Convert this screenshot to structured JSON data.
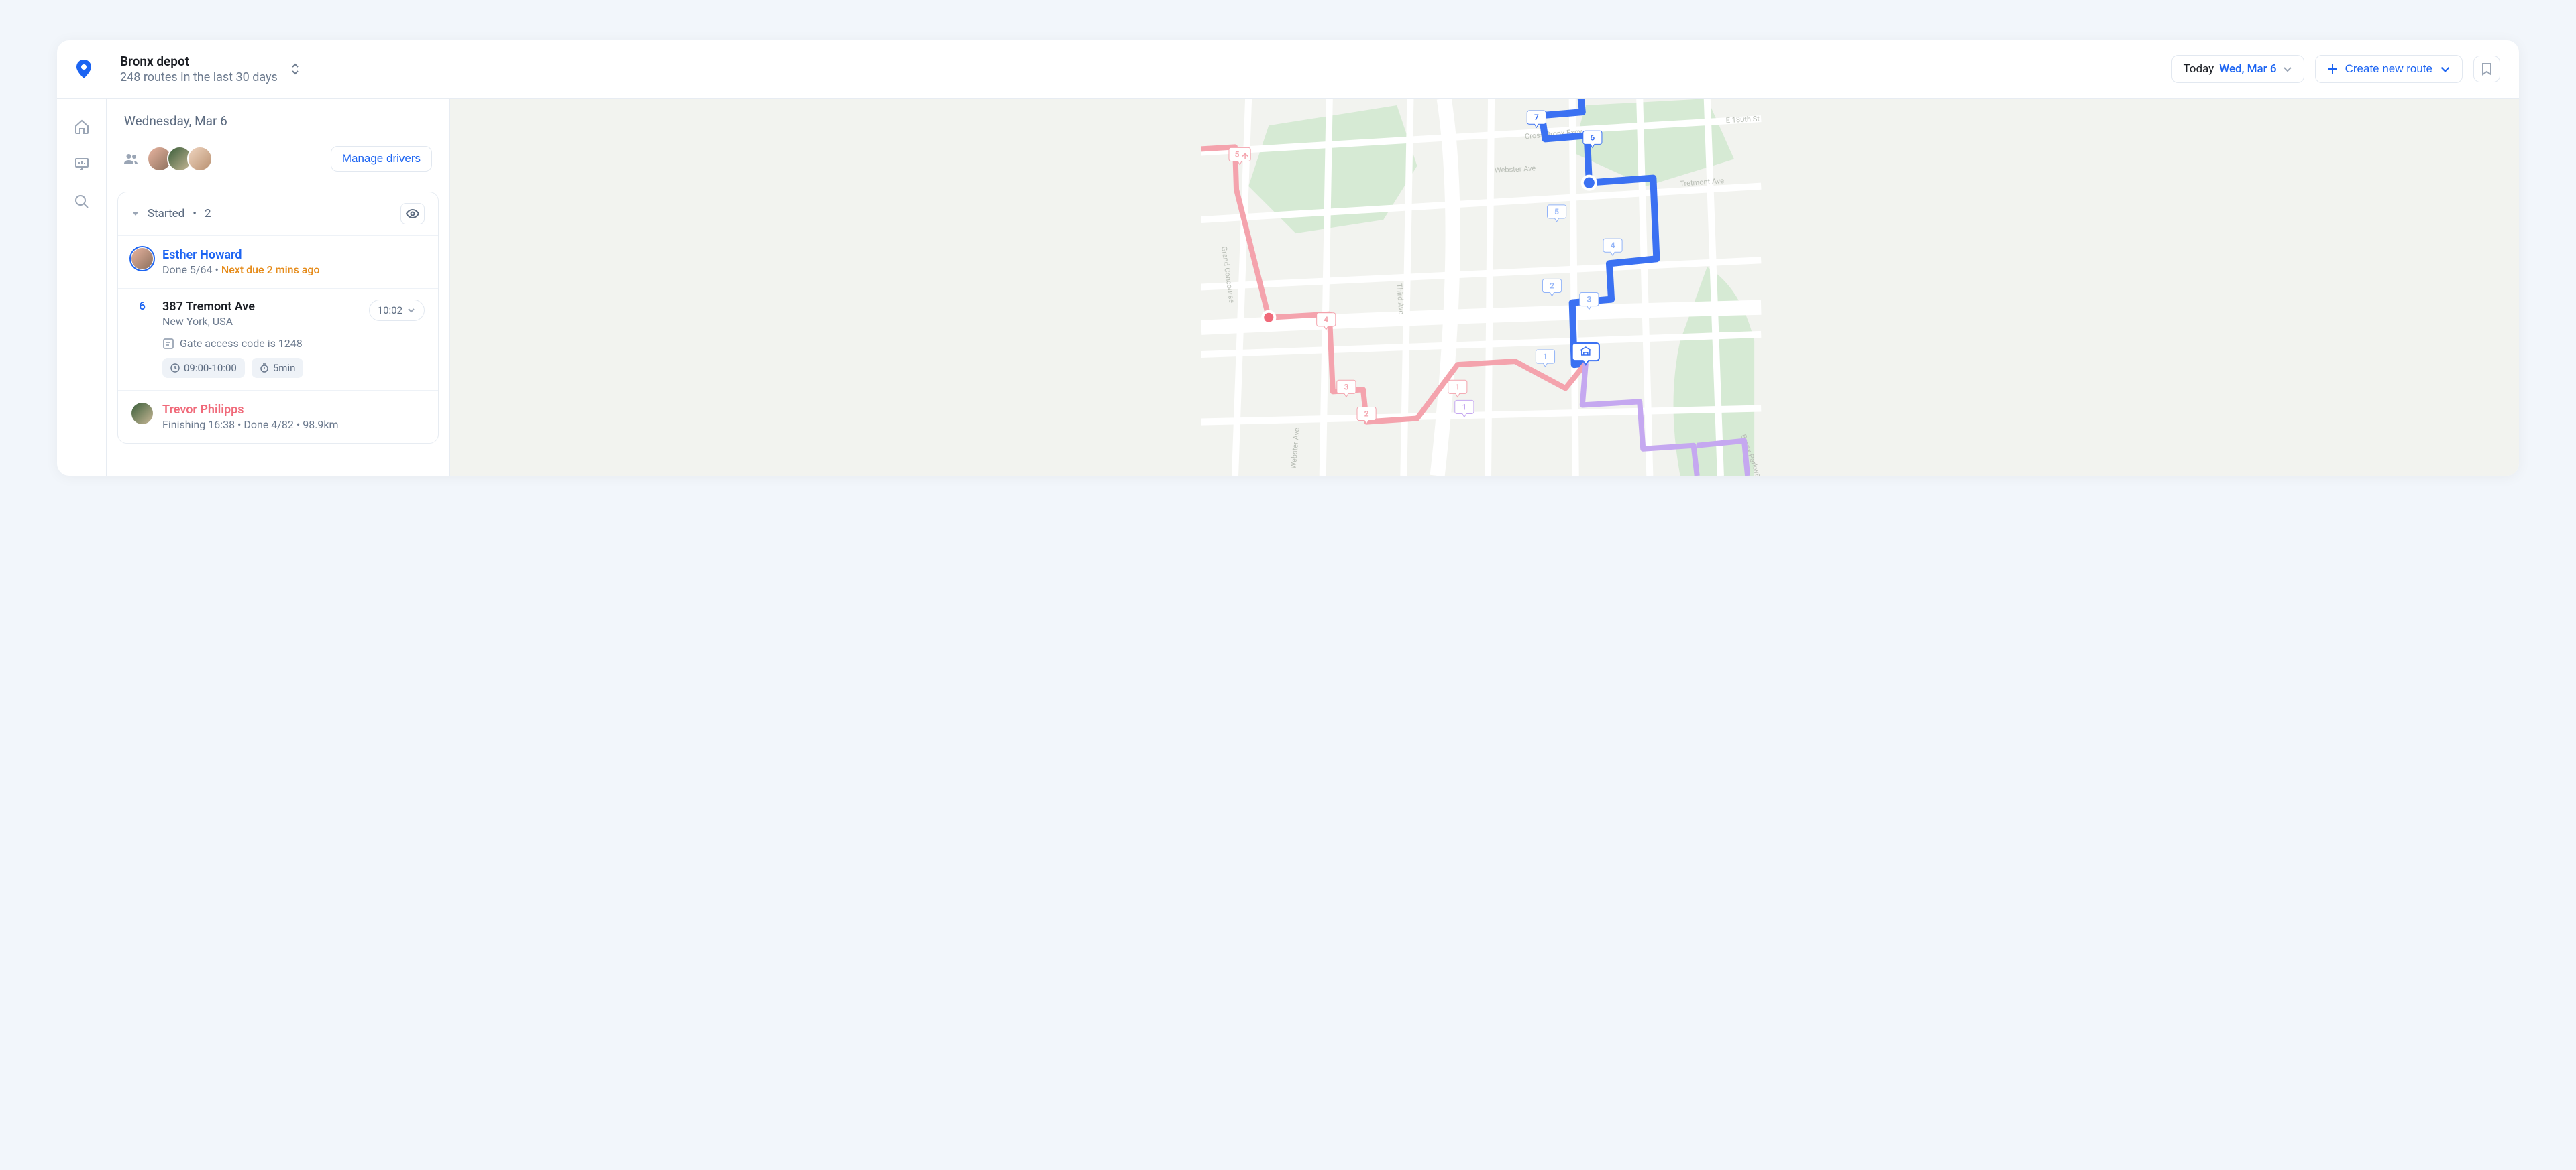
{
  "header": {
    "depot_name": "Bronx depot",
    "depot_sub": "248 routes in the last 30 days",
    "date_prefix": "Today",
    "date_value": "Wed, Mar 6",
    "create_route": "Create new route"
  },
  "panel": {
    "date_hdr": "Wednesday, Mar 6",
    "manage_drivers": "Manage drivers",
    "group_label": "Started",
    "group_count": "2"
  },
  "driver1": {
    "name": "Esther Howard",
    "done": "Done 5/64",
    "warn": "Next due 2 mins ago"
  },
  "stop": {
    "num": "6",
    "addr": "387 Tremont Ave",
    "city": "New York, USA",
    "note": "Gate access code is 1248",
    "window": "09:00-10:00",
    "duration": "5min",
    "eta": "10:02"
  },
  "driver2": {
    "name": "Trevor Philipps",
    "sub": "Finishing 16:38  •  Done 4/82  •  98.9km"
  },
  "map_markers": {
    "m1": "7",
    "m2": "6",
    "m3": "5",
    "m4": "4",
    "m5": "3",
    "m6": "2",
    "m7": "1",
    "r1": "5",
    "r2": "4",
    "r3": "3",
    "r4": "2",
    "r5": "1",
    "p1": "1"
  }
}
